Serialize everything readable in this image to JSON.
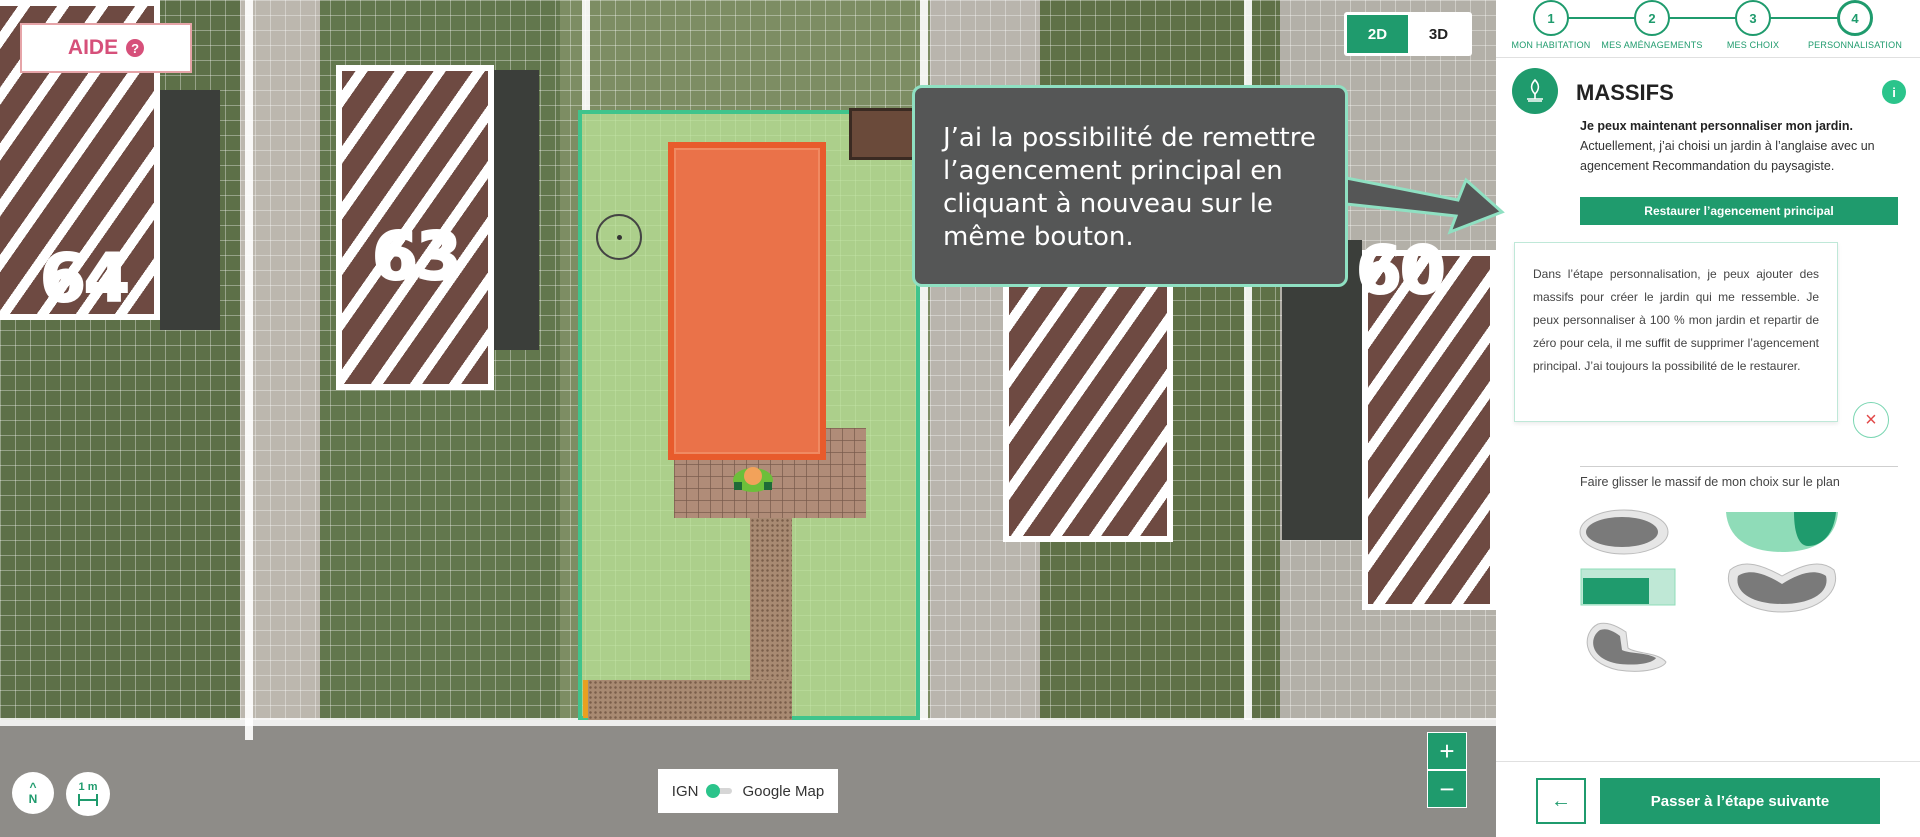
{
  "map": {
    "plot_numbers": [
      "64",
      "63",
      "60"
    ],
    "help_button": {
      "label": "AIDE",
      "icon": "question-circle-icon"
    },
    "view_toggle": {
      "options": [
        "2D",
        "3D"
      ],
      "selected": "2D"
    },
    "tooltip": {
      "text": "J’ai la possibilité de remettre l’agencement principal en cliquant à nouveau sur le même bouton."
    },
    "compass": {
      "label": "N",
      "icon": "arrow-up-icon"
    },
    "scale": {
      "label": "1 m",
      "icon": "ruler-icon"
    },
    "layer_switch": {
      "left": "IGN",
      "right": "Google Map",
      "active": "IGN"
    },
    "zoom": {
      "in": "+",
      "out": "−"
    }
  },
  "panel": {
    "steps": [
      {
        "number": "1",
        "label": "MON HABITATION"
      },
      {
        "number": "2",
        "label": "MES AMÉNAGEMENTS"
      },
      {
        "number": "3",
        "label": "MES CHOIX"
      },
      {
        "number": "4",
        "label": "PERSONNALISATION"
      }
    ],
    "active_step": "4",
    "section": {
      "title": "MASSIFS",
      "icon": "tree-icon",
      "info_icon": "i"
    },
    "intro_bold": "Je peux maintenant personnaliser mon jardin.",
    "intro_text": "Actuellement, j’ai choisi un jardin à l’anglaise avec un agencement Recommandation du paysagiste.",
    "restore_button": "Restaurer l’agencement principal",
    "help_card": "Dans l’étape personnalisation, je peux ajouter des massifs pour créer le jardin qui me ressemble. Je peux personnaliser à 100 % mon jardin et repartir de zéro pour cela, il me suffit de supprimer l’agencement principal. J’ai toujours la possibilité de le restaurer.",
    "close_icon": "×",
    "drag_hint": "Faire glisser le massif de mon choix sur le plan",
    "back_button": "←",
    "next_button": "Passer à l’étape suivante"
  },
  "colors": {
    "accent": "#1f9b6d",
    "accent_light": "#2bc48b",
    "pool": "#ea7249",
    "help_pink": "#d6507a",
    "tooltip_bg": "#555656"
  }
}
